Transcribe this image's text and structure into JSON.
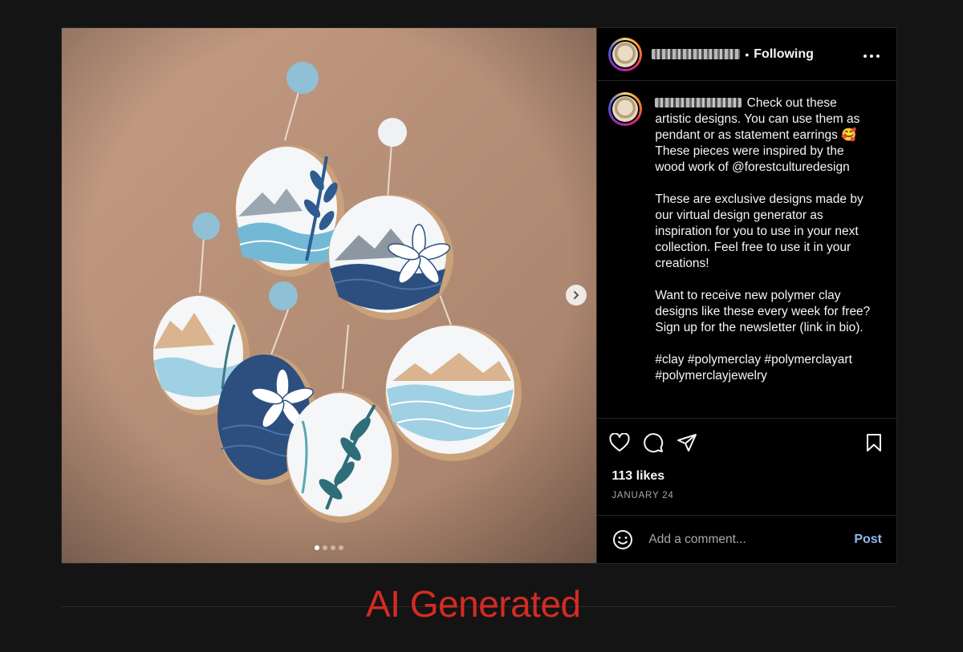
{
  "post": {
    "header": {
      "separator": "•",
      "follow_label": "Following",
      "more_icon": "more-horizontal-icon"
    },
    "caption": {
      "text": "Check out these artistic designs. You can use them as pendant or as statement earrings 🥰\nThese pieces were inspired by the wood work of @forestculturedesign\n\nThese are exclusive designs made by our virtual design generator as inspiration for you to use in your next collection. Feel free to use it in your creations!\n\nWant to receive new polymer clay designs like these every week for free? Sign up for the newsletter (link in bio).\n\n#clay #polymerclay #polymerclayart #polymerclayjewelry"
    },
    "carousel": {
      "slides": 4,
      "current": 1
    },
    "actions": {
      "like_icon": "heart-icon",
      "comment_icon": "comment-icon",
      "share_icon": "send-icon",
      "save_icon": "bookmark-icon"
    },
    "likes": "113 likes",
    "date": "JANUARY 24",
    "comment": {
      "placeholder": "Add a comment...",
      "post_label": "Post"
    }
  },
  "overlay_label": "AI Generated",
  "colors": {
    "accent_link": "#8fb8ef",
    "label_red": "#d42b23",
    "background": "#141414"
  }
}
